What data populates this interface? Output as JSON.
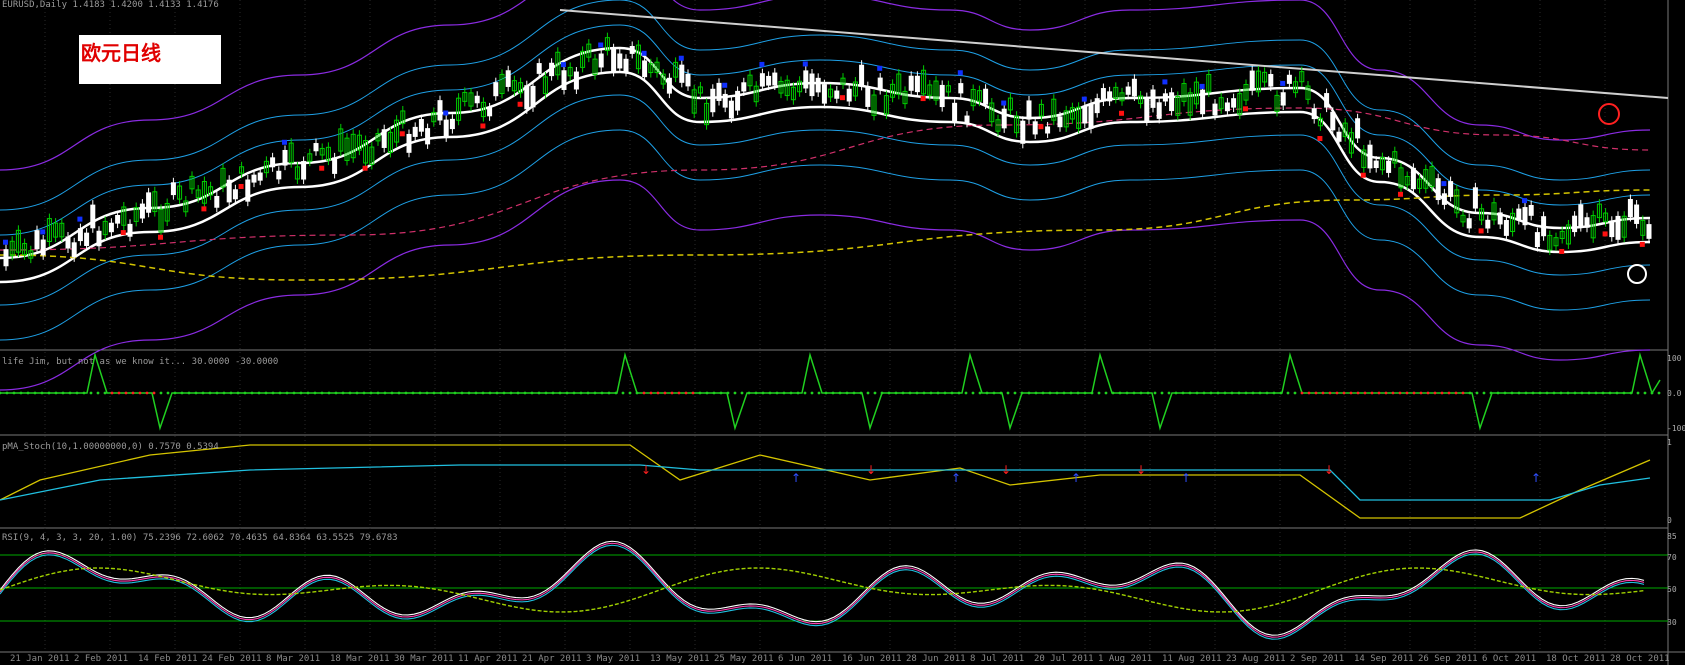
{
  "window": {
    "symbol_header": "EURUSD,Daily  1.4183 1.4200 1.4133 1.4176",
    "annotation_label": "欧元日线"
  },
  "panels": {
    "osc1_header": "life Jim, but not as we know it... 30.0000 -30.0000",
    "osc2_header": "pMA_Stoch(10,1.00000000,0) 0.7570 0.5394",
    "osc3_header": "RSI(9, 4, 3, 3, 20, 1.00) 75.2396 72.6062 70.4635 64.8364 63.5525 79.6783",
    "osc1_axis": [
      "100",
      "0.0",
      "-100"
    ],
    "osc2_axis": [
      "1",
      "0"
    ],
    "osc3_axis": [
      "85",
      "70",
      "50",
      "30"
    ]
  },
  "x_axis": {
    "labels": [
      "21 Jan 2011",
      "2 Feb 2011",
      "14 Feb 2011",
      "24 Feb 2011",
      "8 Mar 2011",
      "18 Mar 2011",
      "30 Mar 2011",
      "11 Apr 2011",
      "21 Apr 2011",
      "3 May 2011",
      "13 May 2011",
      "25 May 2011",
      "6 Jun 2011",
      "16 Jun 2011",
      "28 Jun 2011",
      "8 Jul 2011",
      "20 Jul 2011",
      "1 Aug 2011",
      "11 Aug 2011",
      "23 Aug 2011",
      "2 Sep 2011",
      "14 Sep 2011",
      "26 Sep 2011",
      "6 Oct 2011",
      "18 Oct 2011",
      "28 Oct 2011"
    ]
  },
  "colors": {
    "up_candle": "#00cc00",
    "down_candle": "#ffffff",
    "ma_white": "#ffffff",
    "envelope_cyan": "#1ea0e6",
    "envelope_purple": "#8a2be2",
    "ma_yellow": "#d4c400",
    "ma_pink": "#d0306a",
    "trend_line": "#cfcfcf",
    "grid": "#2a2a2a"
  },
  "chart_data": {
    "type": "line",
    "title": "",
    "series": []
  }
}
